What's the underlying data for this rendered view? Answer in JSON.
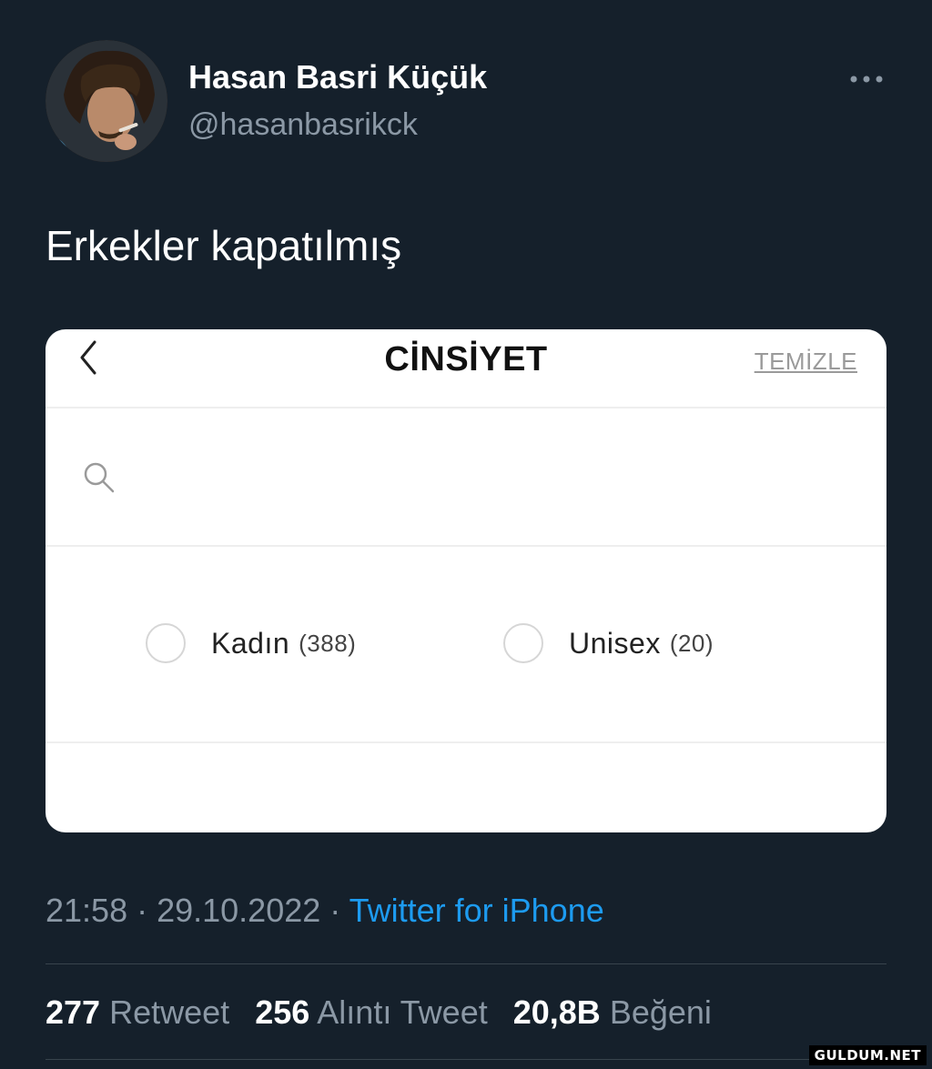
{
  "tweet": {
    "author": {
      "display_name": "Hasan Basri Küçük",
      "handle": "@hasanbasrikck",
      "avatar_icon": "profile-photo"
    },
    "text": "Erkekler kapatılmış",
    "more_icon": "ellipsis-icon",
    "meta": {
      "time": "21:58",
      "separator": " · ",
      "date": "29.10.2022",
      "source": "Twitter for iPhone"
    },
    "stats": {
      "retweets": {
        "count": "277",
        "label": "Retweet"
      },
      "quotes": {
        "count": "256",
        "label": "Alıntı Tweet"
      },
      "likes": {
        "count": "20,8B",
        "label": "Beğeni"
      }
    }
  },
  "screenshot_card": {
    "back_icon": "chevron-left-icon",
    "title": "CİNSİYET",
    "clear_label": "TEMİZLE",
    "search": {
      "icon": "search-icon",
      "placeholder": ""
    },
    "options": [
      {
        "label": "Kadın",
        "count": "(388)",
        "selected": false
      },
      {
        "label": "Unisex",
        "count": "(20)",
        "selected": false
      }
    ]
  },
  "watermark": "GULDUM.NET",
  "colors": {
    "background": "#15202b",
    "link": "#1d9bf0",
    "secondary_text": "#8b98a5",
    "divider": "#38444d"
  }
}
